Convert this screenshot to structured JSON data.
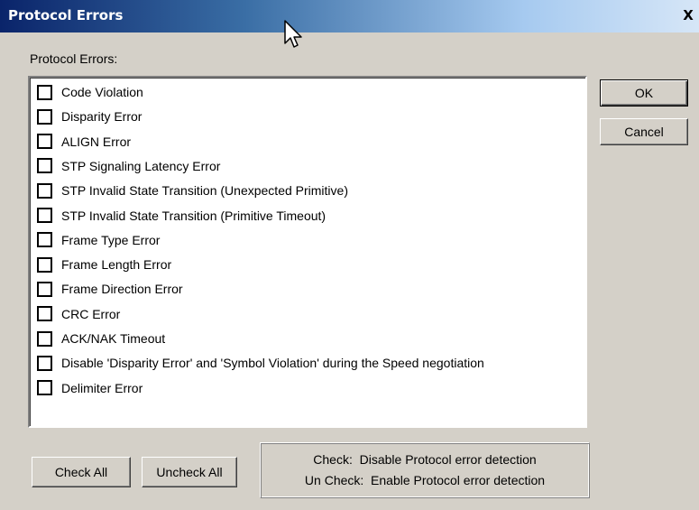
{
  "window": {
    "title": "Protocol Errors",
    "close_glyph": "X"
  },
  "section_label": "Protocol Errors:",
  "errors": [
    {
      "label": "Code Violation",
      "checked": false
    },
    {
      "label": "Disparity Error",
      "checked": false
    },
    {
      "label": "ALIGN Error",
      "checked": false
    },
    {
      "label": "STP Signaling Latency Error",
      "checked": false
    },
    {
      "label": "STP Invalid State Transition (Unexpected Primitive)",
      "checked": false
    },
    {
      "label": "STP Invalid State Transition (Primitive Timeout)",
      "checked": false
    },
    {
      "label": "Frame Type Error",
      "checked": false
    },
    {
      "label": "Frame Length Error",
      "checked": false
    },
    {
      "label": "Frame Direction Error",
      "checked": false
    },
    {
      "label": "CRC Error",
      "checked": false
    },
    {
      "label": "ACK/NAK Timeout",
      "checked": false
    },
    {
      "label": "Disable 'Disparity Error' and 'Symbol Violation' during the Speed negotiation",
      "checked": false
    },
    {
      "label": "Delimiter Error",
      "checked": false
    }
  ],
  "buttons": {
    "ok": "OK",
    "cancel": "Cancel",
    "check_all": "Check All",
    "uncheck_all": "Uncheck All"
  },
  "info": {
    "line1": "Check:  Disable Protocol error detection",
    "line2": "Un Check:  Enable Protocol error detection"
  },
  "colors": {
    "title_bar": "#0a246a",
    "dialog_bg": "#d4d0c8"
  }
}
